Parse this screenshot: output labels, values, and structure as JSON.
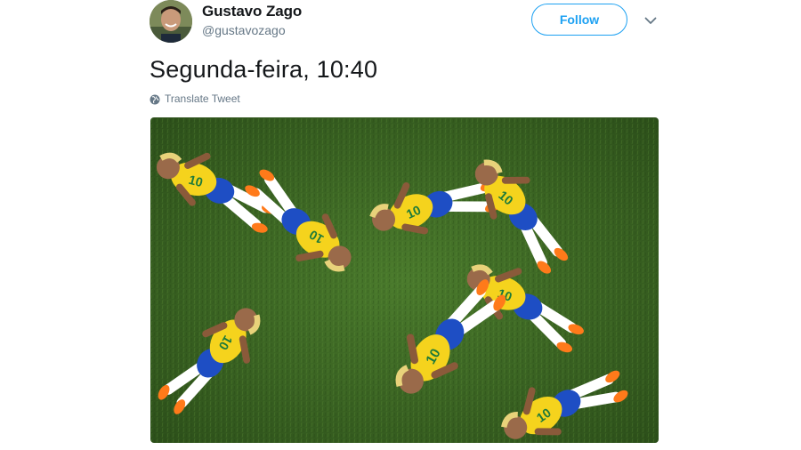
{
  "author": {
    "name": "Gustavo Zago",
    "handle": "@gustavozago",
    "avatar_icon": "user-avatar-photo"
  },
  "actions": {
    "follow_label": "Follow",
    "menu_icon": "chevron-down-icon"
  },
  "tweet": {
    "text": "Segunda-feira, 10:40",
    "translate_label": "Translate Tweet",
    "translate_icon": "globe-icon"
  },
  "media": {
    "description_icon": "photo-collage",
    "jersey_number": "10"
  },
  "colors": {
    "accent": "#1da1f2",
    "text_primary": "#14171a",
    "text_secondary": "#657786",
    "grass": "#3d6a24",
    "jersey_yellow": "#f5d31d",
    "shorts_blue": "#1e4ec4"
  }
}
